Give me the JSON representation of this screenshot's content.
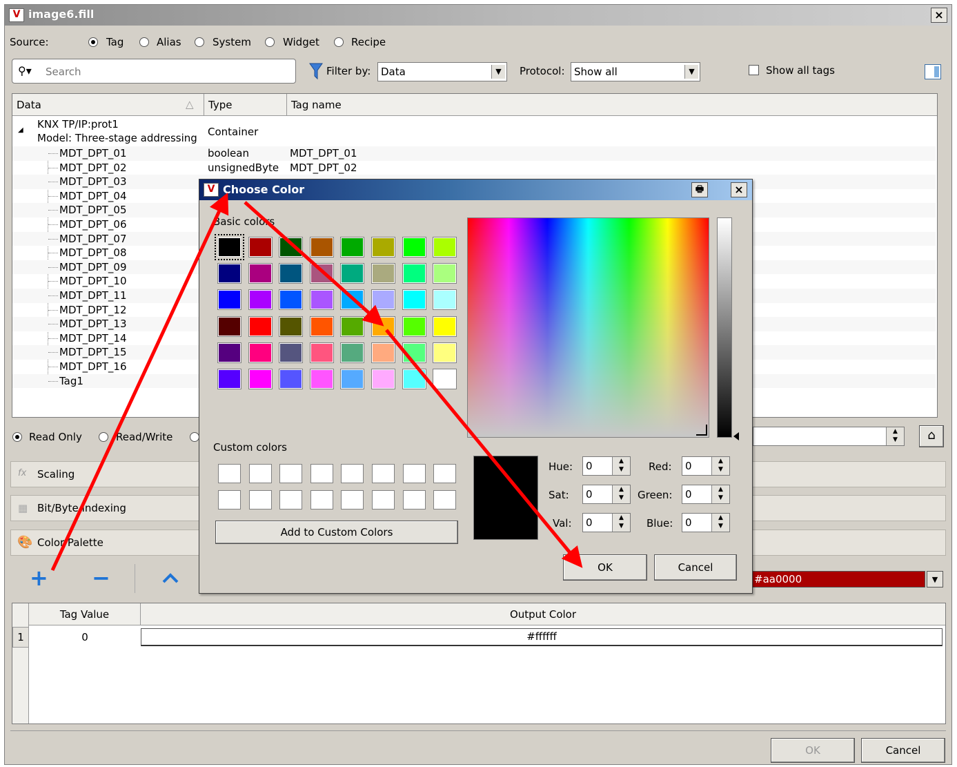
{
  "window": {
    "title": "image6.fill",
    "close": "×"
  },
  "source": {
    "label": "Source:",
    "options": [
      "Tag",
      "Alias",
      "System",
      "Widget",
      "Recipe"
    ],
    "selected": "Tag"
  },
  "search": {
    "placeholder": "Search"
  },
  "filter": {
    "label": "Filter by:",
    "value": "Data"
  },
  "protocol": {
    "label": "Protocol:",
    "value": "Show all"
  },
  "show_all_tags": {
    "label": "Show all tags",
    "checked": false
  },
  "tree": {
    "columns": [
      "Data",
      "Type",
      "Tag name"
    ],
    "root": {
      "label_line1": "KNX TP/IP:prot1",
      "label_line2": "Model: Three-stage addressing",
      "type": "Container"
    },
    "rows": [
      {
        "data": "MDT_DPT_01",
        "type": "boolean",
        "tag": "MDT_DPT_01"
      },
      {
        "data": "MDT_DPT_02",
        "type": "unsignedByte",
        "tag": "MDT_DPT_02"
      },
      {
        "data": "MDT_DPT_03",
        "type": "",
        "tag": ""
      },
      {
        "data": "MDT_DPT_04",
        "type": "",
        "tag": ""
      },
      {
        "data": "MDT_DPT_05",
        "type": "",
        "tag": ""
      },
      {
        "data": "MDT_DPT_06",
        "type": "",
        "tag": ""
      },
      {
        "data": "MDT_DPT_07",
        "type": "",
        "tag": ""
      },
      {
        "data": "MDT_DPT_08",
        "type": "",
        "tag": ""
      },
      {
        "data": "MDT_DPT_09",
        "type": "",
        "tag": ""
      },
      {
        "data": "MDT_DPT_10",
        "type": "",
        "tag": ""
      },
      {
        "data": "MDT_DPT_11",
        "type": "",
        "tag": ""
      },
      {
        "data": "MDT_DPT_12",
        "type": "",
        "tag": ""
      },
      {
        "data": "MDT_DPT_13",
        "type": "",
        "tag": ""
      },
      {
        "data": "MDT_DPT_14",
        "type": "",
        "tag": ""
      },
      {
        "data": "MDT_DPT_15",
        "type": "",
        "tag": ""
      },
      {
        "data": "MDT_DPT_16",
        "type": "",
        "tag": ""
      },
      {
        "data": "Tag1",
        "type": "",
        "tag": ""
      }
    ]
  },
  "access": {
    "options": [
      "Read Only",
      "Read/Write"
    ],
    "selected": "Read Only"
  },
  "sections": {
    "scaling": "Scaling",
    "bit_indexing": "Bit/Byte Indexing",
    "color_palette": "Color Palette"
  },
  "palette_toolbar": {
    "add": "+",
    "remove": "−",
    "up": "^"
  },
  "default_color": {
    "value": "#aa0000",
    "color": "#aa0000"
  },
  "color_table": {
    "columns": [
      "Tag Value",
      "Output Color"
    ],
    "rows": [
      {
        "index": "1",
        "value": "0",
        "color": "#ffffff"
      }
    ]
  },
  "footer": {
    "ok": "OK",
    "cancel": "Cancel"
  },
  "dialog": {
    "title": "Choose Color",
    "basic_label": "Basic colors",
    "basic_colors": [
      "#000000",
      "#aa0000",
      "#005500",
      "#aa5500",
      "#00aa00",
      "#aaaa00",
      "#00ff00",
      "#aaff00",
      "#00007f",
      "#aa007f",
      "#00557f",
      "#aa557f",
      "#00aa7f",
      "#aaaa7f",
      "#00ff7f",
      "#aaff7f",
      "#0000ff",
      "#aa00ff",
      "#0055ff",
      "#aa55ff",
      "#00aaff",
      "#aaaaff",
      "#00ffff",
      "#aaffff",
      "#550000",
      "#ff0000",
      "#555500",
      "#ff5500",
      "#55aa00",
      "#ffaa00",
      "#55ff00",
      "#ffff00",
      "#55007f",
      "#ff007f",
      "#55557f",
      "#ff557f",
      "#55aa7f",
      "#ffaa7f",
      "#55ff7f",
      "#ffff7f",
      "#5500ff",
      "#ff00ff",
      "#5555ff",
      "#ff55ff",
      "#55aaff",
      "#ffaaff",
      "#55ffff",
      "#ffffff"
    ],
    "custom_label": "Custom colors",
    "add_custom": "Add to Custom Colors",
    "current_color": "#000000",
    "fields": {
      "hue_label": "Hue:",
      "hue": "0",
      "sat_label": "Sat:",
      "sat": "0",
      "val_label": "Val:",
      "val": "0",
      "red_label": "Red:",
      "red": "0",
      "green_label": "Green:",
      "green": "0",
      "blue_label": "Blue:",
      "blue": "0"
    },
    "ok": "OK",
    "cancel": "Cancel"
  },
  "annotation_color": "#ff0000"
}
